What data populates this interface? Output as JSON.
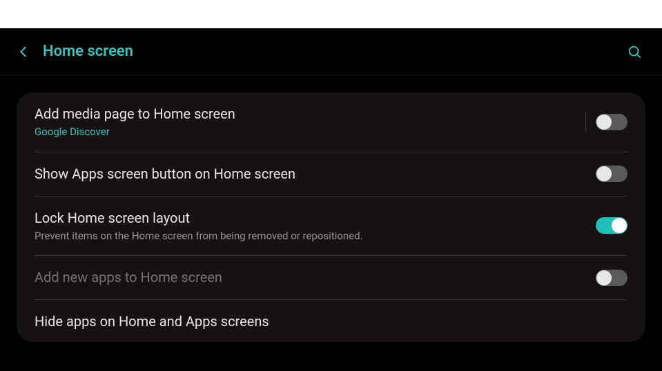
{
  "header": {
    "title": "Home screen"
  },
  "settings": {
    "add_media": {
      "title": "Add media page to Home screen",
      "subtitle": "Google Discover",
      "enabled": false
    },
    "show_apps_button": {
      "title": "Show Apps screen button on Home screen",
      "enabled": false
    },
    "lock_layout": {
      "title": "Lock Home screen layout",
      "subtitle": "Prevent items on the Home screen from being removed or repositioned.",
      "enabled": true
    },
    "add_new_apps": {
      "title": "Add new apps to Home screen",
      "enabled": false,
      "disabled_ui": true
    },
    "hide_apps": {
      "title": "Hide apps on Home and Apps screens"
    }
  }
}
